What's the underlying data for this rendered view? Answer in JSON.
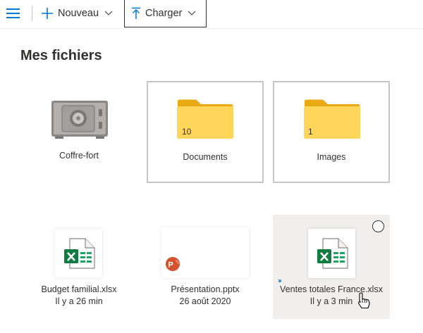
{
  "toolbar": {
    "menu_icon": "hamburger-icon",
    "new_label": "Nouveau",
    "upload_label": "Charger"
  },
  "page_title": "Mes fichiers",
  "accent_color": "#0078d4",
  "items": [
    {
      "name": "Coffre-fort",
      "icon": "vault-icon"
    },
    {
      "name": "Documents",
      "count": "10",
      "icon": "folder-icon"
    },
    {
      "name": "Images",
      "count": "1",
      "icon": "folder-icon"
    },
    {
      "name": "Budget familial.xlsx",
      "modified": "Il y a 26 min",
      "icon": "excel-file-icon"
    },
    {
      "name": "Présentation.pptx",
      "modified": "26 août 2020",
      "icon": "powerpoint-file-icon"
    },
    {
      "name": "Ventes totales France.xlsx",
      "modified": "Il y a 3 min",
      "icon": "excel-file-icon"
    }
  ]
}
